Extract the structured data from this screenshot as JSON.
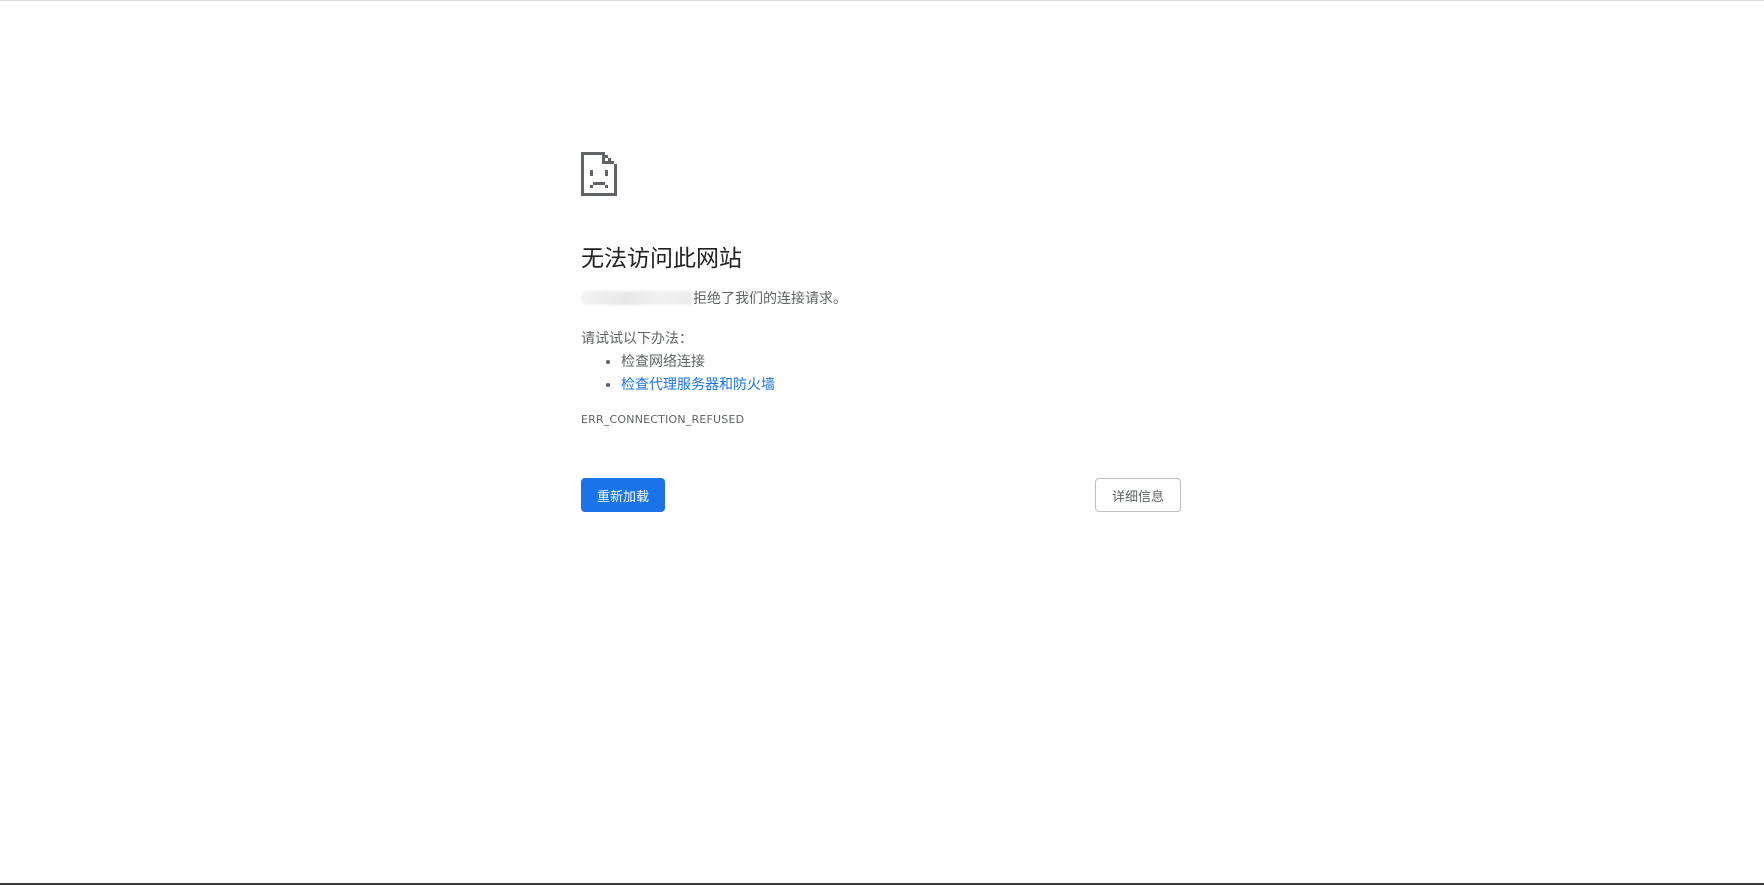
{
  "error_page": {
    "icon": "sad-document-icon",
    "title": "无法访问此网站",
    "description_suffix": "拒绝了我们的连接请求。",
    "suggestions_label": "请试试以下办法：",
    "suggestions": [
      {
        "text": "检查网络连接"
      },
      {
        "text": "检查代理服务器和防火墙"
      }
    ],
    "error_code": "ERR_CONNECTION_REFUSED",
    "reload_button": "重新加载",
    "details_button": "详细信息"
  },
  "colors": {
    "accent": "#1a73e8",
    "title": "#202124",
    "body_text": "#5f6368",
    "background": "#ffffff"
  }
}
